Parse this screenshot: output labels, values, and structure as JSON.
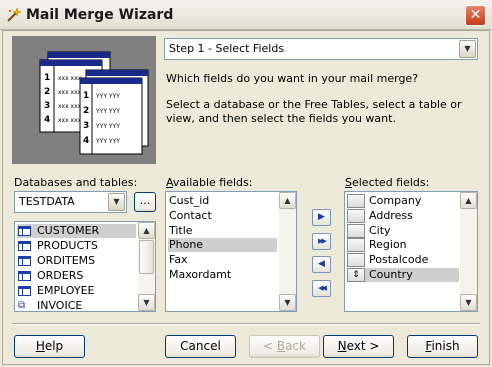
{
  "window": {
    "title": "Mail Merge Wizard",
    "close_glyph": "✕"
  },
  "step": {
    "selected": "Step 1 - Select Fields",
    "question": "Which fields do you want in your mail merge?",
    "instructions": "Select a database or the Free Tables, select a table or view, and then select the fields you want."
  },
  "databases": {
    "label": "Databases and tables:",
    "selected": "TESTDATA",
    "browse_label": "...",
    "tables": [
      {
        "name": "CUSTOMER",
        "icon": "table-icon",
        "selected": true
      },
      {
        "name": "PRODUCTS",
        "icon": "table-icon",
        "selected": false
      },
      {
        "name": "ORDITEMS",
        "icon": "table-icon",
        "selected": false
      },
      {
        "name": "ORDERS",
        "icon": "table-icon",
        "selected": false
      },
      {
        "name": "EMPLOYEE",
        "icon": "table-icon",
        "selected": false
      },
      {
        "name": "INVOICE",
        "icon": "view-icon",
        "selected": false
      }
    ]
  },
  "available": {
    "label_key": "A",
    "label_rest": "vailable fields:",
    "fields": [
      {
        "name": "Cust_id",
        "selected": false
      },
      {
        "name": "Contact",
        "selected": false
      },
      {
        "name": "Title",
        "selected": false
      },
      {
        "name": "Phone",
        "selected": true
      },
      {
        "name": "Fax",
        "selected": false
      },
      {
        "name": "Maxordamt",
        "selected": false
      }
    ]
  },
  "selected_fields": {
    "label_key": "S",
    "label_rest": "elected fields:",
    "fields": [
      {
        "name": "Company",
        "selected": false,
        "mover": ""
      },
      {
        "name": "Address",
        "selected": false,
        "mover": ""
      },
      {
        "name": "City",
        "selected": false,
        "mover": ""
      },
      {
        "name": "Region",
        "selected": false,
        "mover": ""
      },
      {
        "name": "Postalcode",
        "selected": false,
        "mover": ""
      },
      {
        "name": "Country",
        "selected": true,
        "mover": "⇕"
      }
    ]
  },
  "move_buttons": {
    "add": "▶",
    "add_all": "▶▶",
    "remove": "◀",
    "remove_all": "◀◀"
  },
  "buttons": {
    "help_key": "H",
    "help_rest": "elp",
    "cancel": "Cancel",
    "back_prefix": "< ",
    "back_key": "B",
    "back_rest": "ack",
    "next_key": "N",
    "next_rest": "ext >",
    "finish_key": "F",
    "finish_rest": "inish"
  },
  "glyphs": {
    "dropdown": "▼",
    "scroll_up": "▲",
    "scroll_down": "▼"
  },
  "colors": {
    "selection": "#cfcfcf",
    "picture_bg": "#808080",
    "close_button": "#c5391a"
  }
}
